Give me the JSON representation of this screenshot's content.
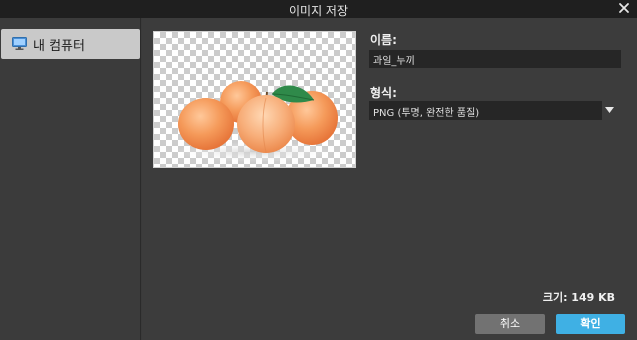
{
  "window": {
    "title": "이미지 저장",
    "close_icon": "close-icon"
  },
  "sidebar": {
    "items": [
      {
        "label": "내 컴퓨터",
        "icon": "computer-icon",
        "selected": true
      }
    ]
  },
  "preview": {
    "content": "peaches image on transparent background"
  },
  "form": {
    "name_label": "이름:",
    "name_value": "과일_누끼",
    "format_label": "형식:",
    "format_value": "PNG (투명, 완전한 품질)",
    "size_text": "크기: 149 KB"
  },
  "buttons": {
    "cancel": "취소",
    "ok": "확인"
  },
  "colors": {
    "accent": "#3fb0e4",
    "titlebar": "#1f1f1f",
    "selected_item": "#c9c9c9"
  }
}
